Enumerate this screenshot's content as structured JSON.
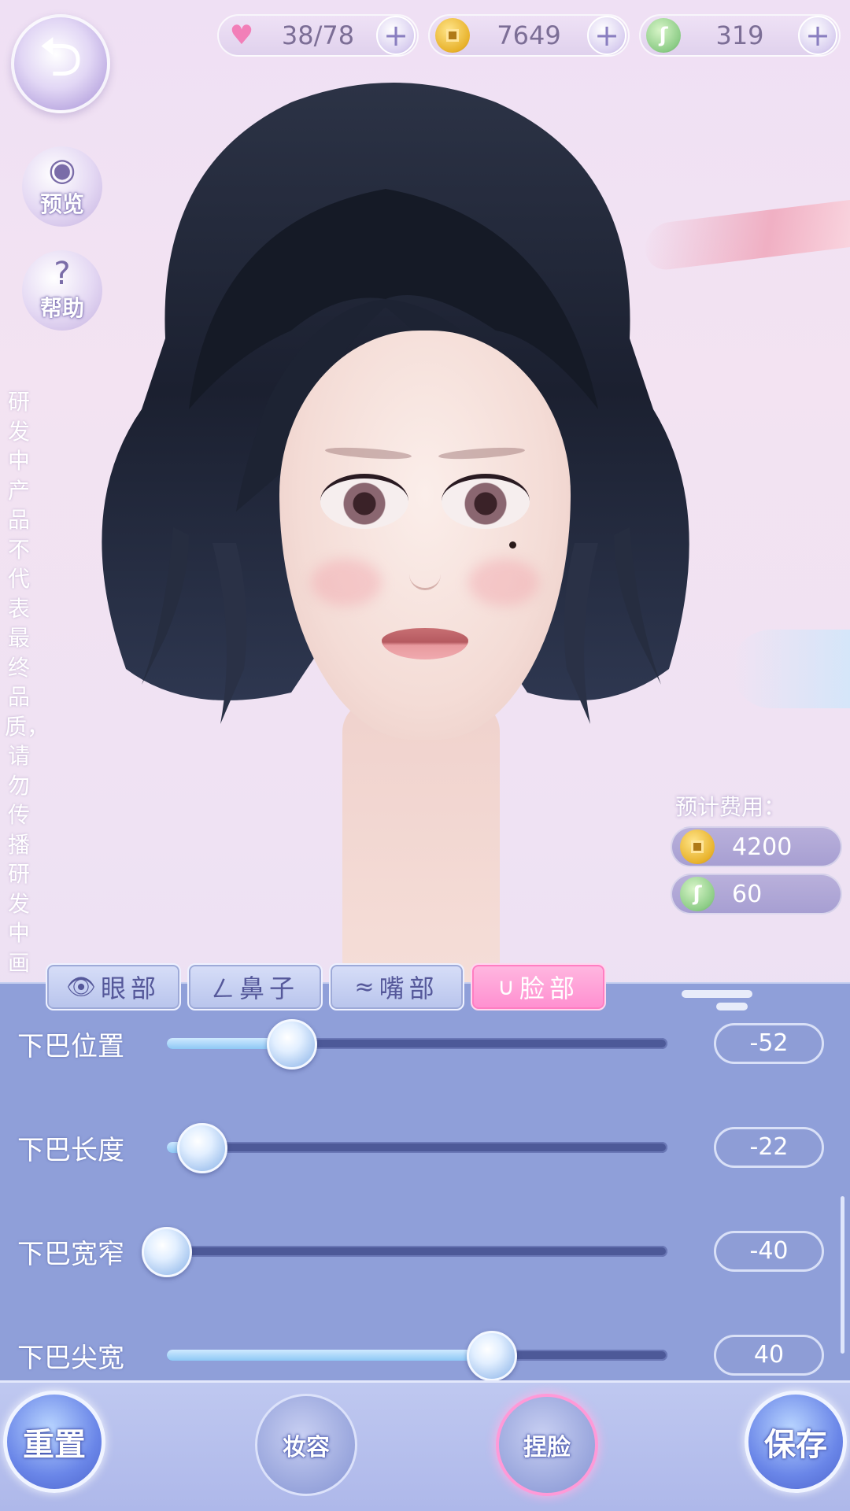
{
  "top_bar": {
    "stamina": "38/78",
    "coins": "7649",
    "jade": "319",
    "plus": "+"
  },
  "side": {
    "back_icon": "back-arrow-icon",
    "preview_label": "预览",
    "help_label": "帮助"
  },
  "disclaimer": "研发中产品不代表最终品质，请勿传播研发中画",
  "cost": {
    "title": "预计费用：",
    "coin_cost": "4200",
    "jade_cost": "60"
  },
  "tabs": [
    {
      "icon": "eye-icon",
      "glyph": "👁",
      "label": "眼部"
    },
    {
      "icon": "nose-icon",
      "glyph": "ㄥ",
      "label": "鼻子"
    },
    {
      "icon": "lips-icon",
      "glyph": "≈",
      "label": "嘴部"
    },
    {
      "icon": "face-icon",
      "glyph": "∪",
      "label": "脸部",
      "active": true
    }
  ],
  "sliders": [
    {
      "label": "下巴位置",
      "value": "-52",
      "level": 0.25
    },
    {
      "label": "下巴长度",
      "value": "-22",
      "level": 0.07
    },
    {
      "label": "下巴宽窄",
      "value": "-40",
      "level": 0.0
    },
    {
      "label": "下巴尖宽",
      "value": "40",
      "level": 0.65
    }
  ],
  "bottom": {
    "reset": "重置",
    "makeup": "妆容",
    "face_shape": "捏脸",
    "save": "保存"
  },
  "colors": {
    "panel": "#8f9fd9",
    "track": "#4d5998",
    "active_tab": "#ff8fd0",
    "hair": "#1f2535"
  }
}
